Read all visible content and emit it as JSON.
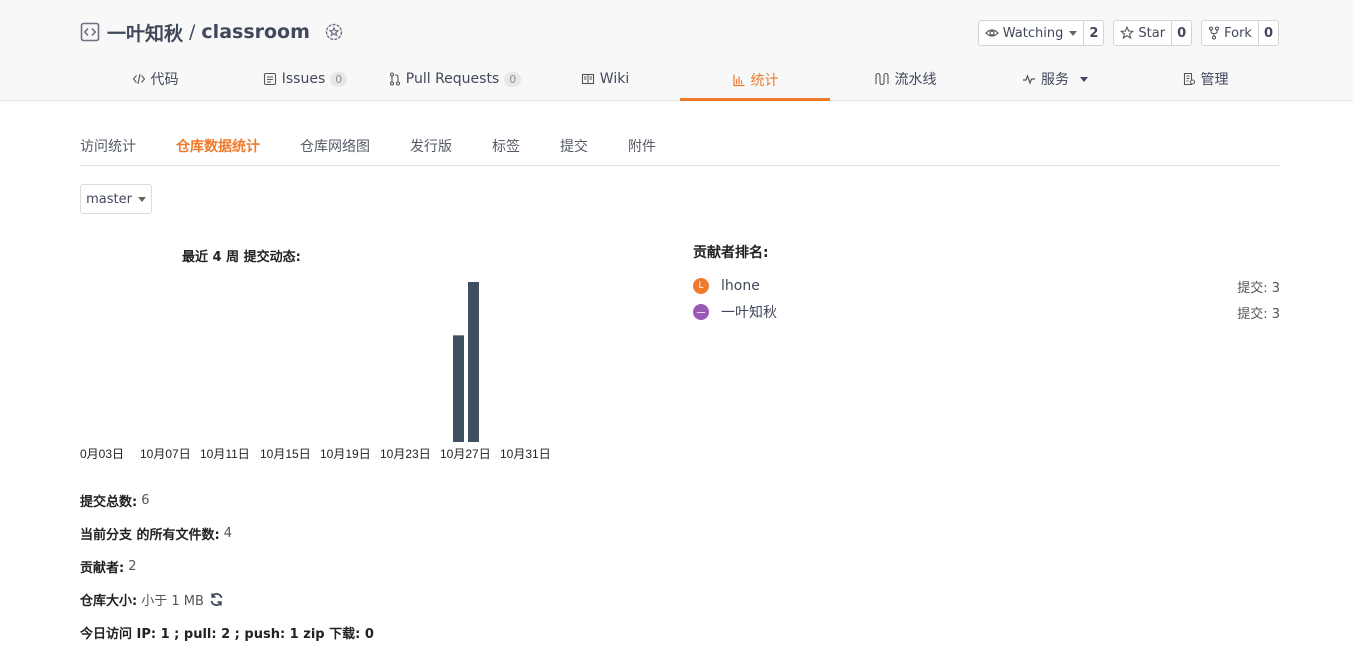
{
  "repo": {
    "owner": "一叶知秋",
    "separator": "/",
    "name": "classroom"
  },
  "actions": {
    "watching": {
      "label": "Watching",
      "count": "2"
    },
    "star": {
      "label": "Star",
      "count": "0"
    },
    "fork": {
      "label": "Fork",
      "count": "0"
    }
  },
  "tabs": [
    {
      "label": "代码",
      "icon": "code-icon"
    },
    {
      "label": "Issues",
      "count": "0",
      "icon": "issues-icon"
    },
    {
      "label": "Pull Requests",
      "count": "0",
      "icon": "pull-request-icon"
    },
    {
      "label": "Wiki",
      "icon": "book-icon"
    },
    {
      "label": "统计",
      "icon": "bar-chart-icon",
      "active": true
    },
    {
      "label": "流水线",
      "icon": "pipeline-icon"
    },
    {
      "label": "服务",
      "icon": "pulse-icon"
    },
    {
      "label": "管理",
      "icon": "settings-doc-icon"
    }
  ],
  "subnav": [
    "访问统计",
    "仓库数据统计",
    "仓库网络图",
    "发行版",
    "标签",
    "提交",
    "附件"
  ],
  "branch": {
    "label": "master"
  },
  "chart_data": {
    "type": "bar",
    "title": "最近 4 周 提交动态:",
    "x_labels": [
      "0月03日",
      "10月07日",
      "10月11日",
      "10月15日",
      "10月19日",
      "10月23日",
      "10月27日",
      "10月31日"
    ],
    "bars": [
      {
        "day_offset": 24,
        "value": 2
      },
      {
        "day_offset": 25,
        "value": 3
      }
    ],
    "ylim": [
      0,
      3
    ],
    "color": "#3f4f5f"
  },
  "stats": {
    "total_commits_label": "提交总数:",
    "total_commits": "6",
    "files_label": "当前分支 的所有文件数:",
    "files": "4",
    "contributors_label": "贡献者:",
    "contributors": "2",
    "size_label": "仓库大小:",
    "size": "小于 1 MB",
    "visits": "今日访问 IP: 1 ; pull: 2 ; push: 1 zip 下载: 0"
  },
  "contributors": {
    "title": "贡献者排名:",
    "items": [
      {
        "name": "lhone",
        "avatar_letter": "L",
        "avatar_color": "#f07a2c",
        "commits": "提交: 3"
      },
      {
        "name": "一叶知秋",
        "avatar_letter": "一",
        "avatar_color": "#9b59b6",
        "commits": "提交: 3"
      }
    ]
  }
}
